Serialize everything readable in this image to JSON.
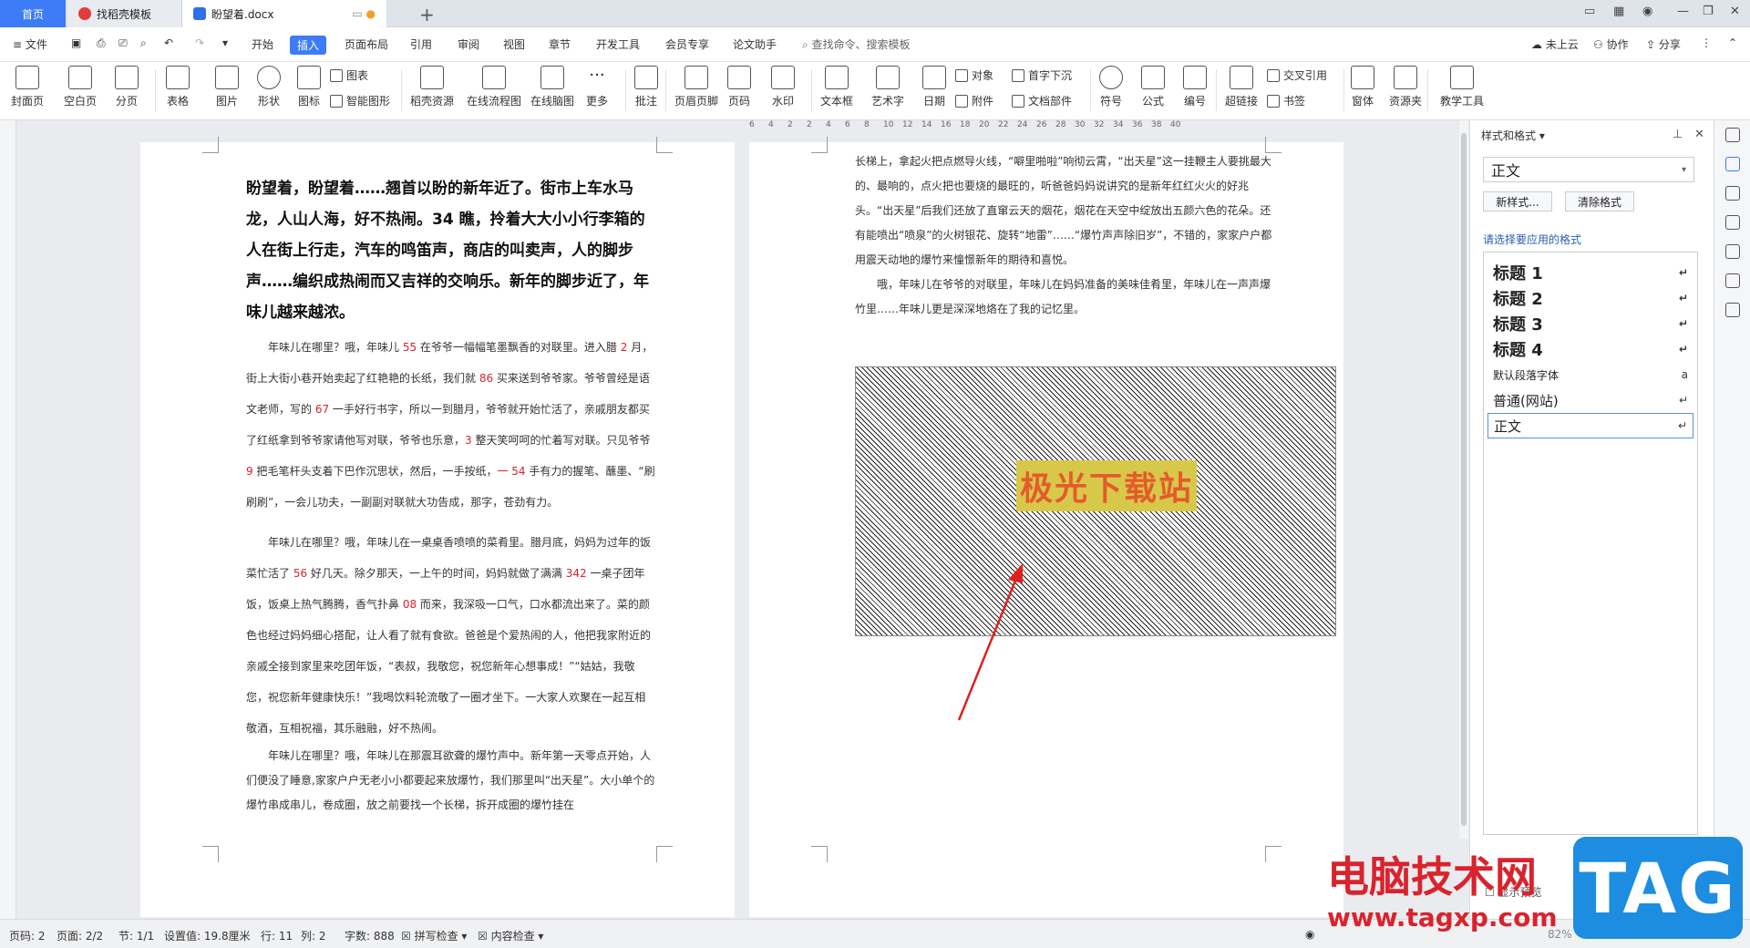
{
  "tabs": {
    "home": "首页",
    "template": "找稻壳模板",
    "document": "盼望着.docx"
  },
  "menu": {
    "file": "文件",
    "items": [
      "开始",
      "插入",
      "页面布局",
      "引用",
      "审阅",
      "视图",
      "章节",
      "开发工具",
      "会员专享",
      "论文助手"
    ],
    "active": "插入",
    "search": "查找命令、搜索模板",
    "cloud": "未上云",
    "collab": "协作",
    "share": "分享"
  },
  "toolbar": {
    "cover": "封面页",
    "blank": "空白页",
    "pagebreak": "分页",
    "table": "表格",
    "picture": "图片",
    "shape": "形状",
    "icon": "图标",
    "chart": "图表",
    "smartart": "智能图形",
    "docer": "稻壳资源",
    "flowchart": "在线流程图",
    "mindmap": "在线脑图",
    "more": "更多",
    "comment": "批注",
    "headerfooter": "页眉页脚",
    "pagenum": "页码",
    "watermark": "水印",
    "textbox": "文本框",
    "wordart": "艺术字",
    "date": "日期",
    "object": "对象",
    "attachment": "附件",
    "dropcap": "首字下沉",
    "docparts": "文档部件",
    "symbol": "符号",
    "formula": "公式",
    "numbering": "编号",
    "hyperlink": "超链接",
    "crossref": "交叉引用",
    "bookmark": "书签",
    "form": "窗体",
    "resources": "资源夹",
    "teaching": "教学工具"
  },
  "ruler": [
    "6",
    "4",
    "2",
    "2",
    "4",
    "6",
    "8",
    "10",
    "12",
    "14",
    "16",
    "18",
    "20",
    "22",
    "24",
    "26",
    "28",
    "30",
    "32",
    "34",
    "36",
    "38",
    "40"
  ],
  "page1": {
    "heading": "盼望着，盼望着……翘首以盼的新年近了。街市上车水马龙，人山人海，好不热闹。34 瞧，拎着大大小小行李箱的人在街上行走，汽车的鸣笛声，商店的叫卖声，人的脚步声……编织成热闹而又吉祥的交响乐。新年的脚步近了，年味儿越来越浓。",
    "para1": [
      {
        "t": "年味儿在哪里？哦，年味儿 "
      },
      {
        "n": "55"
      },
      {
        "t": " 在爷爷一幅幅笔墨飘香的对联里。进入腊 "
      },
      {
        "n": "2"
      },
      {
        "t": " 月，街上大街小巷开始卖起了红艳艳的长纸，我们就 "
      },
      {
        "n": "86"
      },
      {
        "t": " 买来送到爷爷家。爷爷曾经是语文老师，写的 "
      },
      {
        "n": "67"
      },
      {
        "t": " 一手好行书字，所以一到腊月，爷爷就开始忙活了，亲戚朋友都买了红纸拿到爷爷家请他写对联，爷爷也乐意，"
      },
      {
        "n": "3"
      },
      {
        "t": " 整天笑呵呵的忙着写对联。只见爷爷 "
      },
      {
        "n": "9"
      },
      {
        "t": " 把毛笔杆头支着下巴作沉思状，然后，一手按纸，"
      },
      {
        "n": "一 54"
      },
      {
        "t": " 手有力的握笔、蘸墨、“刷刷刷”，一会儿功夫，一副副对联就大功告成，那字，苍劲有力。"
      }
    ],
    "para2": [
      {
        "t": "年味儿在哪里？哦，年味儿在一桌桌香喷喷的菜肴里。腊月底，妈妈为过年的饭菜忙活了 "
      },
      {
        "n": "56"
      },
      {
        "t": " 好几天。除夕那天，一上午的时间，妈妈就做了满满 "
      },
      {
        "n": "342"
      },
      {
        "t": " 一桌子团年饭，饭桌上热气腾腾，香气扑鼻 "
      },
      {
        "n": "08"
      },
      {
        "t": " 而来，我深吸一口气，口水都流出来了。菜的颜色也经过妈妈细心搭配，让人看了就有食欲。爸爸是个爱热闹的人，他把我家附近的亲戚全接到家里来吃团年饭，“表叔，我敬您，祝您新年心想事成！”“姑姑，我敬您，祝您新年健康快乐！”我喝饮料轮流敬了一圈才坐下。一大家人欢聚在一起互相敬酒，互相祝福，其乐融融，好不热闹。"
      }
    ],
    "para3": "年味儿在哪里？哦，年味儿在那震耳欲聋的爆竹声中。新年第一天零点开始，人们便没了睡意,家家户户无老小小都要起来放爆竹，我们那里叫“出天星”。大小单个的爆竹串成串儿，卷成圈，放之前要找一个长梯，拆开成圈的爆竹挂在"
  },
  "page2": {
    "para1": "长梯上，拿起火把点燃导火线，“噼里啪啦”响彻云霄，“出天星”这一挂鞭主人要挑最大的、最响的，点火把也要烧的最旺的，听爸爸妈妈说讲究的是新年红红火火的好兆头。“出天星”后我们还放了直窜云天的烟花，烟花在天空中绽放出五颜六色的花朵。还有能喷出“喷泉”的火树银花、旋转“地雷”……“爆竹声声除旧岁”，不错的，家家户户都用震天动地的爆竹来憧憬新年的期待和喜悦。",
    "para2": "哦，年味儿在爷爷的对联里，年味儿在妈妈准备的美味佳肴里，年味儿在一声声爆竹里……年味儿更是深深地烙在了我的记忆里。",
    "watermark_text": "极光下载站"
  },
  "sidepanel": {
    "title": "样式和格式",
    "current_style": "正文",
    "new_style": "新样式...",
    "clear_format": "清除格式",
    "hint": "请选择要应用的格式",
    "styles": [
      "标题 1",
      "标题 2",
      "标题 3",
      "标题 4",
      "默认段落字体",
      "普通(网站)",
      "正文"
    ],
    "selected": "正文",
    "footer_text": "显示预览"
  },
  "status": {
    "page": "页码: 2",
    "pages": "页面: 2/2",
    "section": "节: 1/1",
    "setting": "设置值: 19.8厘米",
    "row": "行: 11",
    "col": "列: 2",
    "words": "字数: 888",
    "spell": "拼写检查",
    "content": "内容检查",
    "zoom": "82%"
  },
  "overlay": {
    "site_name": "电脑技术网",
    "site_url": "www.tagxp.com",
    "tag": "TAG"
  },
  "colors": {
    "accent": "#3d7bf7",
    "number_red": "#d9232d",
    "arrow_red": "#e02020",
    "overlay_red": "#d9232d",
    "tag_blue": "#1c8de0"
  }
}
